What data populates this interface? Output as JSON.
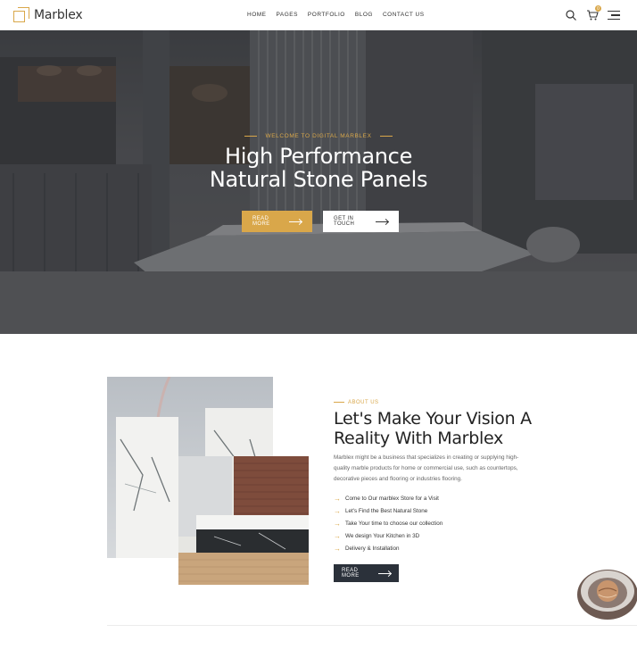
{
  "brand": {
    "name": "Marblex",
    "accent": "#d9a74a",
    "dark": "#2b313a"
  },
  "nav": {
    "items": [
      "HOME",
      "PAGES",
      "PORTFOLIO",
      "BLOG",
      "CONTACT US"
    ]
  },
  "header": {
    "cart_count": "0",
    "icons": [
      "search-icon",
      "cart-icon",
      "menu-icon"
    ]
  },
  "hero": {
    "eyebrow": "WELCOME TO DIGITAL MARBLEX",
    "title_line1": "High Performance",
    "title_line2": "Natural Stone Panels",
    "primary_button": "READ MORE",
    "secondary_button": "GET IN TOUCH"
  },
  "about": {
    "label": "ABOUT US",
    "title_line1": "Let's Make Your Vision A",
    "title_line2": "Reality With Marblex",
    "description": "Marblex might be a business that specializes in creating or supplying high-quality marble products for home or commercial use, such as countertops, decorative pieces and flooring or industries flooring.",
    "features": [
      "Come to Our marblex Store for a Visit",
      "Let's Find the Best Natural Stone",
      "Take Your time to choose our collection",
      "We design Your Kitchen in 3D",
      "Delivery & Installation"
    ],
    "button": "READ MORE"
  }
}
